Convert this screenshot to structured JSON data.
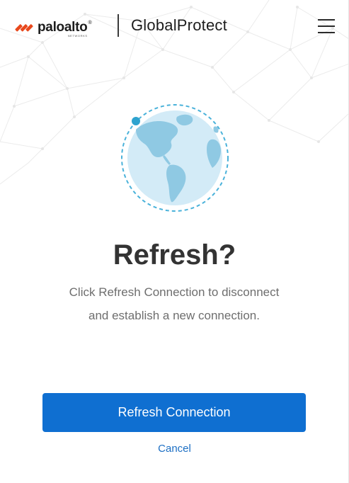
{
  "header": {
    "brand_name": "paloalto",
    "brand_sub": "NETWORKS",
    "brand_registered": "®",
    "product_name": "GlobalProtect",
    "menu_icon": "hamburger-menu-icon"
  },
  "main": {
    "illustration_icon": "globe-icon",
    "title": "Refresh?",
    "message_line1": "Click Refresh Connection to disconnect",
    "message_line2": "and establish a new connection."
  },
  "actions": {
    "primary_label": "Refresh Connection",
    "cancel_label": "Cancel"
  },
  "colors": {
    "primary": "#0f6fd1",
    "link": "#1d6fc4",
    "brand_orange": "#e8481c",
    "globe_ocean": "#d3ebf7",
    "globe_land": "#8fc9e3",
    "globe_accent": "#2ea3cf"
  }
}
